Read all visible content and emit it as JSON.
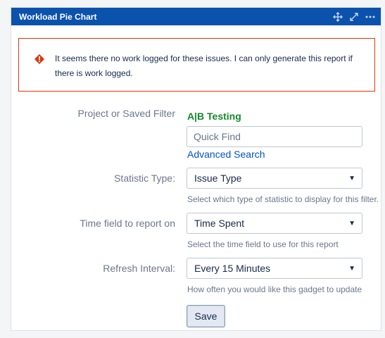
{
  "gadget": {
    "title": "Workload Pie Chart",
    "header_icons": [
      "move-icon",
      "maximize-icon",
      "more-icon"
    ]
  },
  "warning": {
    "icon": "error-icon",
    "message": "It seems there no work logged for these issues. I can only generate this report if there is work logged.",
    "color": "#de350b"
  },
  "form": {
    "project_label": "Project or Saved Filter",
    "project_value": "A|B Testing",
    "quick_find_placeholder": "Quick Find",
    "quick_find_value": "",
    "advanced_search_label": "Advanced Search",
    "statistic_label": "Statistic Type:",
    "statistic_value": "Issue Type",
    "statistic_help": "Select which type of statistic to display for this filter.",
    "time_field_label": "Time field to report on",
    "time_field_value": "Time Spent",
    "time_field_help": "Select the time field to use for this report",
    "refresh_label": "Refresh Interval:",
    "refresh_value": "Every 15 Minutes",
    "refresh_help": "How often you would like this gadget to update",
    "save_label": "Save"
  },
  "colors": {
    "header": "#0b52ad",
    "project_green": "#14892c",
    "link_blue": "#0052cc"
  }
}
